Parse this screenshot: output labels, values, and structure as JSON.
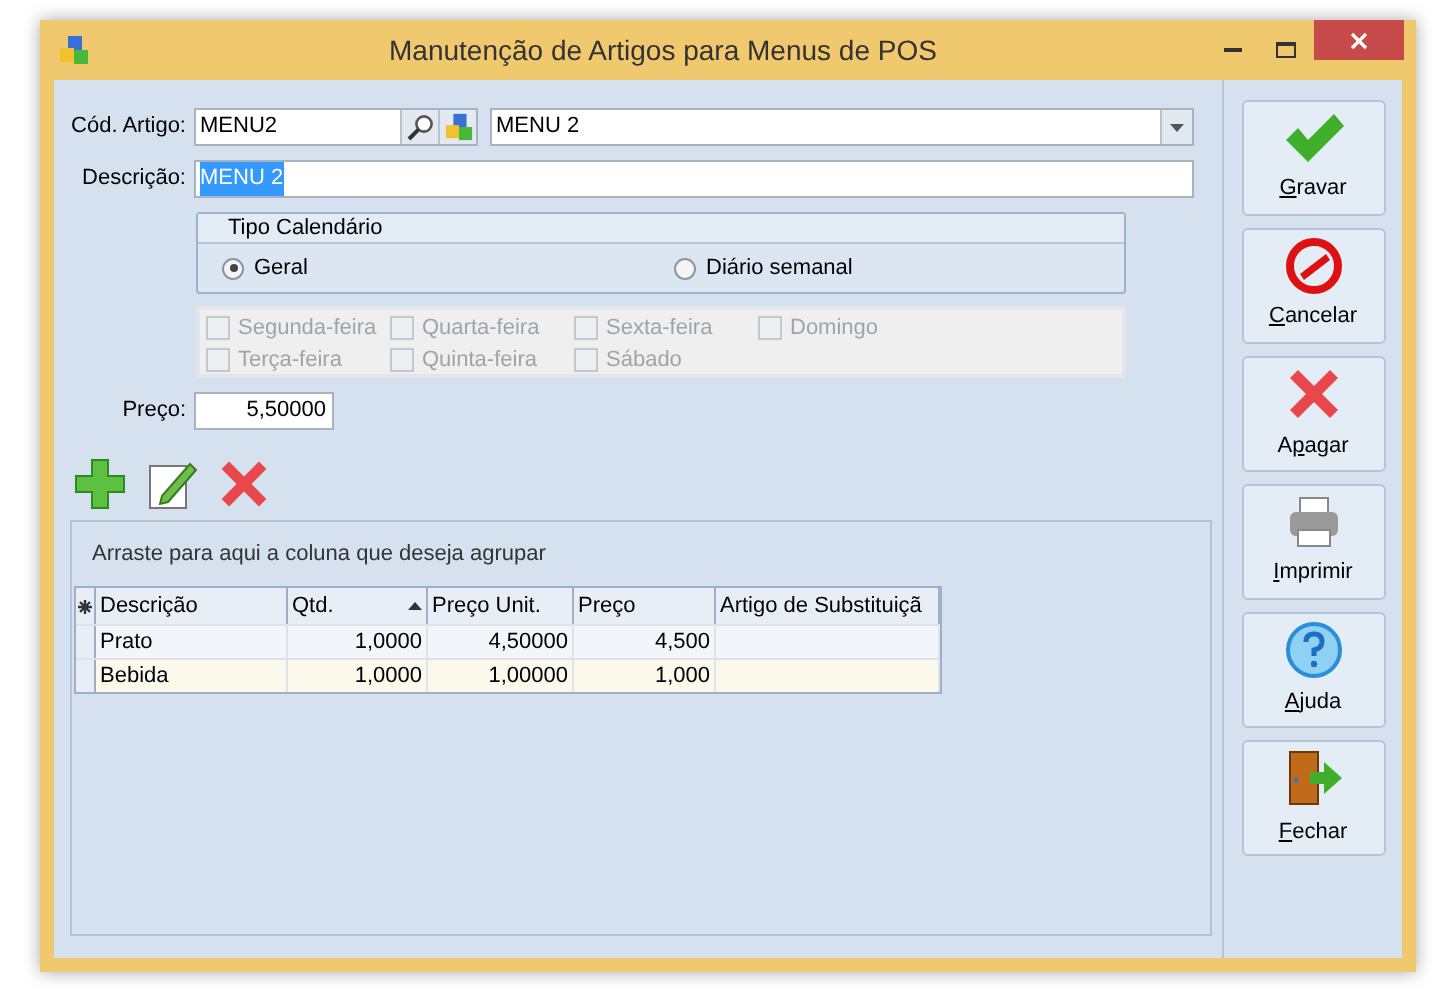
{
  "window": {
    "title": "Manutenção de Artigos para Menus de POS"
  },
  "form": {
    "code": {
      "label": "Cód. Artigo:",
      "value": "MENU2",
      "name_value": "MENU 2"
    },
    "description": {
      "label": "Descrição:",
      "value": "MENU 2",
      "selected": true
    },
    "calendar": {
      "title": "Tipo Calendário",
      "options": [
        {
          "label": "Geral",
          "selected": true
        },
        {
          "label": "Diário semanal",
          "selected": false
        }
      ]
    },
    "days": [
      {
        "label": "Segunda-feira",
        "checked": false,
        "disabled": true
      },
      {
        "label": "Terça-feira",
        "checked": false,
        "disabled": true
      },
      {
        "label": "Quarta-feira",
        "checked": false,
        "disabled": true
      },
      {
        "label": "Quinta-feira",
        "checked": false,
        "disabled": true
      },
      {
        "label": "Sexta-feira",
        "checked": false,
        "disabled": true
      },
      {
        "label": "Sábado",
        "checked": false,
        "disabled": true
      },
      {
        "label": "Domingo",
        "checked": false,
        "disabled": true
      }
    ],
    "price": {
      "label": "Preço:",
      "value": "5,50000"
    }
  },
  "toolbar": [
    {
      "kind": "add"
    },
    {
      "kind": "edit"
    },
    {
      "kind": "delete"
    }
  ],
  "grid": {
    "group_hint": "Arraste para aqui a coluna que deseja agrupar",
    "columns": [
      {
        "label": "Descrição",
        "sorted": false
      },
      {
        "label": "Qtd.",
        "sorted": true
      },
      {
        "label": "Preço Unit.",
        "sorted": false
      },
      {
        "label": "Preço",
        "sorted": false
      },
      {
        "label": "Artigo de Substituiçã",
        "sorted": false
      }
    ],
    "rows": [
      [
        "Prato",
        "1,0000",
        "4,50000",
        "4,500",
        null
      ],
      [
        "Bebida",
        "1,0000",
        "1,00000",
        "1,000",
        null
      ]
    ]
  },
  "actions": [
    {
      "kind": "save",
      "key": "G",
      "post": "ravar"
    },
    {
      "kind": "cancel",
      "key": "C",
      "post": "ancelar"
    },
    {
      "kind": "delete",
      "pre": "A",
      "key": "p",
      "post": "agar"
    },
    {
      "kind": "print",
      "key": "I",
      "post": "mprimir"
    },
    {
      "kind": "help",
      "key": "A",
      "post": "juda"
    },
    {
      "kind": "close",
      "key": "F",
      "post": "echar"
    }
  ]
}
